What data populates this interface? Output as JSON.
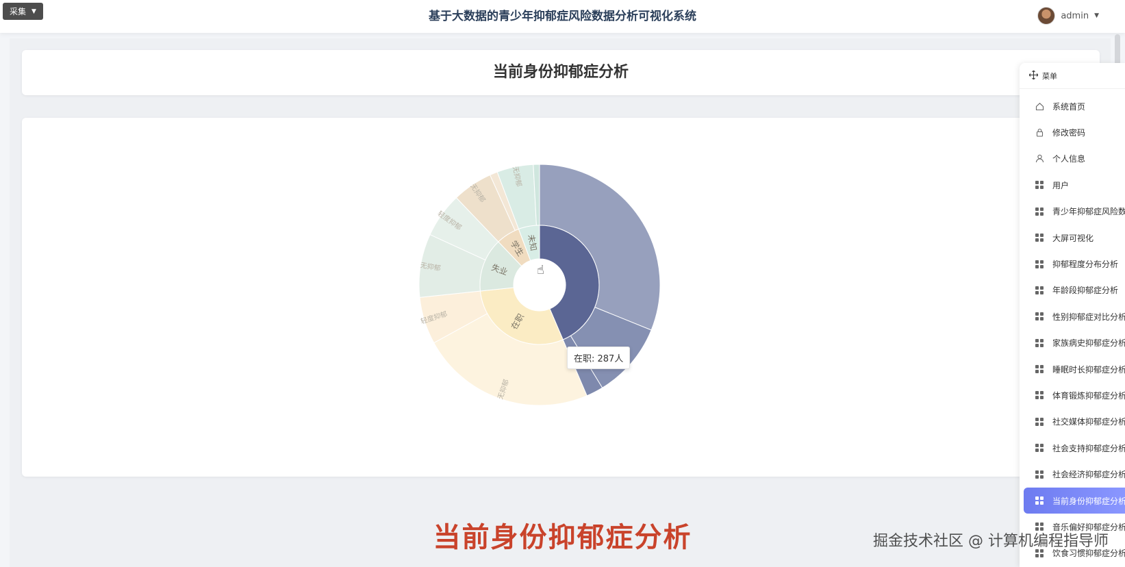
{
  "header": {
    "collect_label": "采集",
    "app_title": "基于大数据的青少年抑郁症风险数据分析可视化系统",
    "username": "admin"
  },
  "page": {
    "card_title": "当前身份抑郁症分析",
    "big_caption": "当前身份抑郁症分析",
    "watermark": "掘金技术社区 @ 计算机编程指导师"
  },
  "tooltip": {
    "text": "在职: 287人"
  },
  "menu": {
    "head_label": "菜单",
    "items": [
      {
        "label": "系统首页",
        "icon": "home-icon"
      },
      {
        "label": "修改密码",
        "icon": "lock-icon"
      },
      {
        "label": "个人信息",
        "icon": "user-icon"
      },
      {
        "label": "用户",
        "icon": "grid-icon"
      },
      {
        "label": "青少年抑郁症风险数据",
        "icon": "grid-icon"
      },
      {
        "label": "大屏可视化",
        "icon": "grid-icon"
      },
      {
        "label": "抑郁程度分布分析",
        "icon": "grid-icon"
      },
      {
        "label": "年龄段抑郁症分析",
        "icon": "grid-icon"
      },
      {
        "label": "性别抑郁症对比分析",
        "icon": "grid-icon"
      },
      {
        "label": "家族病史抑郁症分析",
        "icon": "grid-icon"
      },
      {
        "label": "睡眠时长抑郁症分析",
        "icon": "grid-icon"
      },
      {
        "label": "体育锻炼抑郁症分析",
        "icon": "grid-icon"
      },
      {
        "label": "社交媒体抑郁症分析",
        "icon": "grid-icon"
      },
      {
        "label": "社会支持抑郁症分析",
        "icon": "grid-icon"
      },
      {
        "label": "社会经济抑郁症分析",
        "icon": "grid-icon"
      },
      {
        "label": "当前身份抑郁症分析",
        "icon": "grid-icon",
        "active": true
      },
      {
        "label": "音乐偏好抑郁症分析",
        "icon": "grid-icon"
      },
      {
        "label": "饮食习惯抑郁症分析",
        "icon": "grid-icon"
      }
    ]
  },
  "chart_data": {
    "type": "sunburst",
    "title": "",
    "inner": [
      {
        "name": "在职",
        "value": 287,
        "color": "#fbecc4"
      },
      {
        "name": "失业",
        "value": 140,
        "color": "#dbe9e0"
      },
      {
        "name": "学生",
        "value": 62,
        "color": "#f0dcc0"
      },
      {
        "name": "未知",
        "value": 55,
        "color": "#d8ede6"
      },
      {
        "name": "",
        "value": 420,
        "color": "#5b6694"
      }
    ],
    "outer": [
      {
        "parent": 0,
        "name": "无抑郁",
        "value": 226,
        "color": "#fdf3df"
      },
      {
        "parent": 0,
        "name": "轻度抑郁",
        "value": 61,
        "color": "#fcefdb"
      },
      {
        "parent": 1,
        "name": "无抑郁",
        "value": 82,
        "color": "#e2ede6"
      },
      {
        "parent": 1,
        "name": "轻度抑郁",
        "value": 58,
        "color": "#e6f0ea"
      },
      {
        "parent": 2,
        "name": "无抑郁",
        "value": 52,
        "color": "#eee0cb"
      },
      {
        "parent": 2,
        "name": "",
        "value": 10,
        "color": "#f3e7d6"
      },
      {
        "parent": 3,
        "name": "无抑郁",
        "value": 47,
        "color": "#d9ece5"
      },
      {
        "parent": 3,
        "name": "",
        "value": 8,
        "color": "#cfe6de"
      },
      {
        "parent": 4,
        "name": "",
        "value": 300,
        "color": "#97a0bd"
      },
      {
        "parent": 4,
        "name": "",
        "value": 98,
        "color": "#8590b2"
      },
      {
        "parent": 4,
        "name": "",
        "value": 22,
        "color": "#7e89ad"
      }
    ]
  }
}
